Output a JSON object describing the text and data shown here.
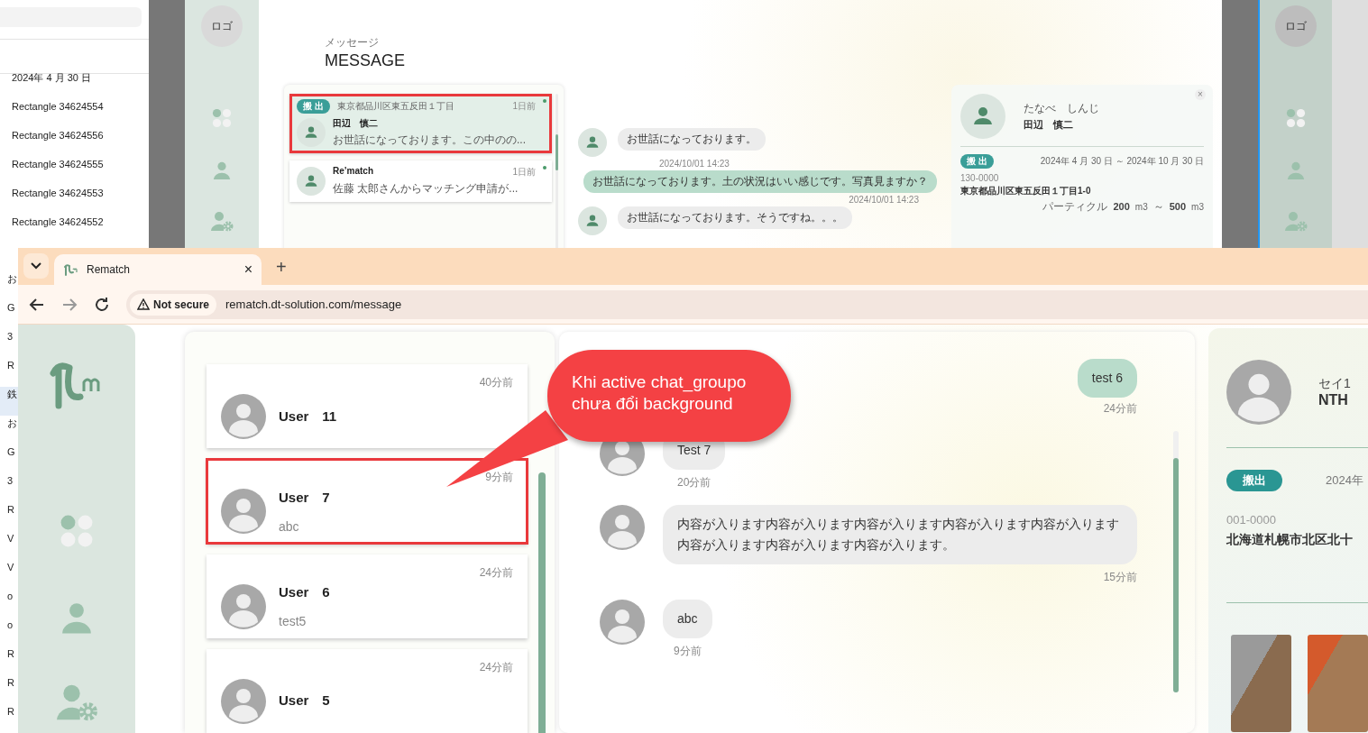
{
  "layers_panel": {
    "items": [
      {
        "label": "2024年 4 月 30 日"
      },
      {
        "label": "Rectangle 34624554"
      },
      {
        "label": "Rectangle 34624556"
      },
      {
        "label": "Rectangle 34624555"
      },
      {
        "label": "Rectangle 34624553"
      },
      {
        "label": "Rectangle 34624552"
      }
    ],
    "cut_rows": [
      {
        "text": "お",
        "selected": false
      },
      {
        "text": "G",
        "selected": false
      },
      {
        "text": "3",
        "selected": false
      },
      {
        "text": "R",
        "selected": false
      },
      {
        "text": "鉄",
        "selected": true
      },
      {
        "text": "お",
        "selected": false
      },
      {
        "text": "G",
        "selected": false
      },
      {
        "text": "3",
        "selected": false
      },
      {
        "text": "R",
        "selected": false
      },
      {
        "text": "V",
        "selected": false
      },
      {
        "text": "V",
        "selected": false
      },
      {
        "text": "o",
        "selected": false
      },
      {
        "text": "o",
        "selected": false
      },
      {
        "text": "R",
        "selected": false
      },
      {
        "text": "R",
        "selected": false
      },
      {
        "text": "R",
        "selected": false
      }
    ]
  },
  "design_frame": {
    "logo": "ロゴ",
    "subtitle": "メッセージ",
    "title": "MESSAGE",
    "conversations": [
      {
        "tag": "搬 出",
        "address": "東京都品川区東五反田１丁目",
        "name": "田辺　慎二",
        "preview": "お世話になっております。この中のの...",
        "time": "1日前",
        "unread": true,
        "selected": true,
        "highlighted": true
      },
      {
        "name": "Re’match",
        "preview": "佐藤 太郎さんからマッチング申請が...",
        "time": "1日前",
        "unread": true,
        "selected": false,
        "highlighted": false
      }
    ],
    "messages": [
      {
        "kind": "received",
        "text": "お世話になっております。",
        "time": "2024/10/01 14:23"
      },
      {
        "kind": "sent",
        "text": "お世話になっております。土の状況はいい感じです。写真見ますか？",
        "time": "2024/10/01 14:23"
      },
      {
        "kind": "received",
        "text": "お世話になっております。そうですね。。。"
      }
    ],
    "profile": {
      "close": "×",
      "furigana": "たなべ　しんじ",
      "name": "田辺　慎二",
      "tag": "搬 出",
      "period": "2024年 4 月 30 日 ～ 2024年 10 月 30 日",
      "zip": "130-0000",
      "address": "東京都品川区東五反田１丁目1-0",
      "volume": {
        "label": "パーティクル",
        "from": "200",
        "from_unit": "m3",
        "separator": "～",
        "to": "500",
        "to_unit": "m3"
      }
    }
  },
  "design_frame_2": {
    "logo": "ロゴ"
  },
  "browser": {
    "tab": {
      "title": "Rematch",
      "close": "×"
    },
    "new_tab": "+",
    "security": "Not secure",
    "url": "rematch.dt-solution.com/message"
  },
  "app": {
    "conversations": [
      {
        "time": "40分前",
        "name": "User　11",
        "highlighted": false
      },
      {
        "time": "9分前",
        "name": "User　7",
        "preview": "abc",
        "highlighted": true
      },
      {
        "time": "24分前",
        "name": "User　6",
        "preview": "test5",
        "highlighted": false
      },
      {
        "time": "24分前",
        "name": "User　5",
        "highlighted": false
      }
    ],
    "messages": [
      {
        "kind": "sent",
        "text": "test 6",
        "time": "24分前"
      },
      {
        "kind": "received",
        "text": "Test 7",
        "time": "20分前"
      },
      {
        "kind": "received",
        "text": "内容が入ります内容が入ります内容が入ります内容が入ります内容が入ります内容が入ります内容が入ります内容が入ります。",
        "time": "15分前"
      },
      {
        "kind": "received",
        "text": "abc",
        "time": "9分前"
      }
    ],
    "profile": {
      "furigana": "セイ1",
      "name": "NTH",
      "tag": "搬出",
      "period": "2024年",
      "zip": "001-0000",
      "address": "北海道札幌市北区北十"
    }
  },
  "annotation": {
    "text": "Khi active chat_groupo chưa đổi background"
  }
}
